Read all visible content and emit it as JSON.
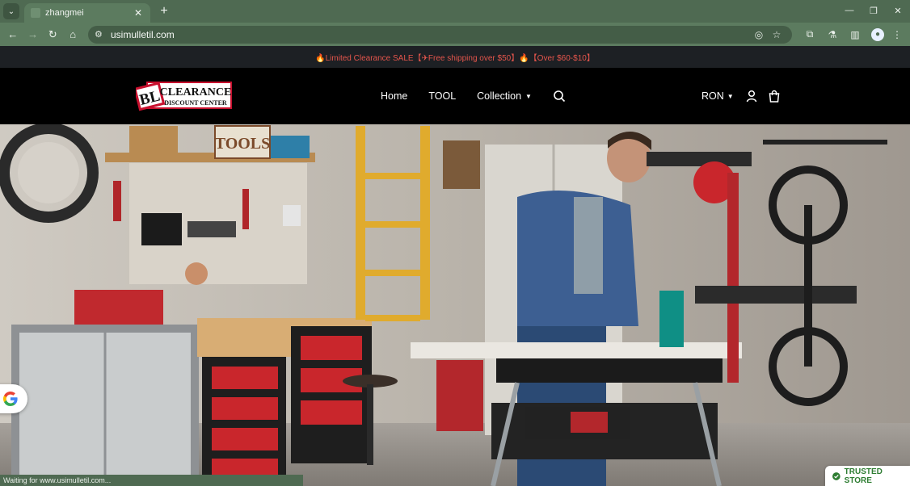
{
  "browser": {
    "tab_title": "zhangmei",
    "url": "usimulletil.com",
    "status_text": "Waiting for www.usimulletil.com..."
  },
  "announcement": "🔥Limited Clearance SALE【✈Free shipping over $50】🔥【Over $60-$10】",
  "logo": {
    "mark": "BL",
    "line1": "CLEARANCE",
    "line2": "DISCOUNT CENTER"
  },
  "nav": {
    "home": "Home",
    "tool": "TOOL",
    "collection": "Collection"
  },
  "currency": "RON",
  "pegboard_sign": "TOOLS",
  "trusted_badge": "TRUSTED STORE",
  "colors": {
    "chrome": "#5c7b5f",
    "announcement_text": "#e4554c",
    "trusted_green": "#2e7d32"
  }
}
